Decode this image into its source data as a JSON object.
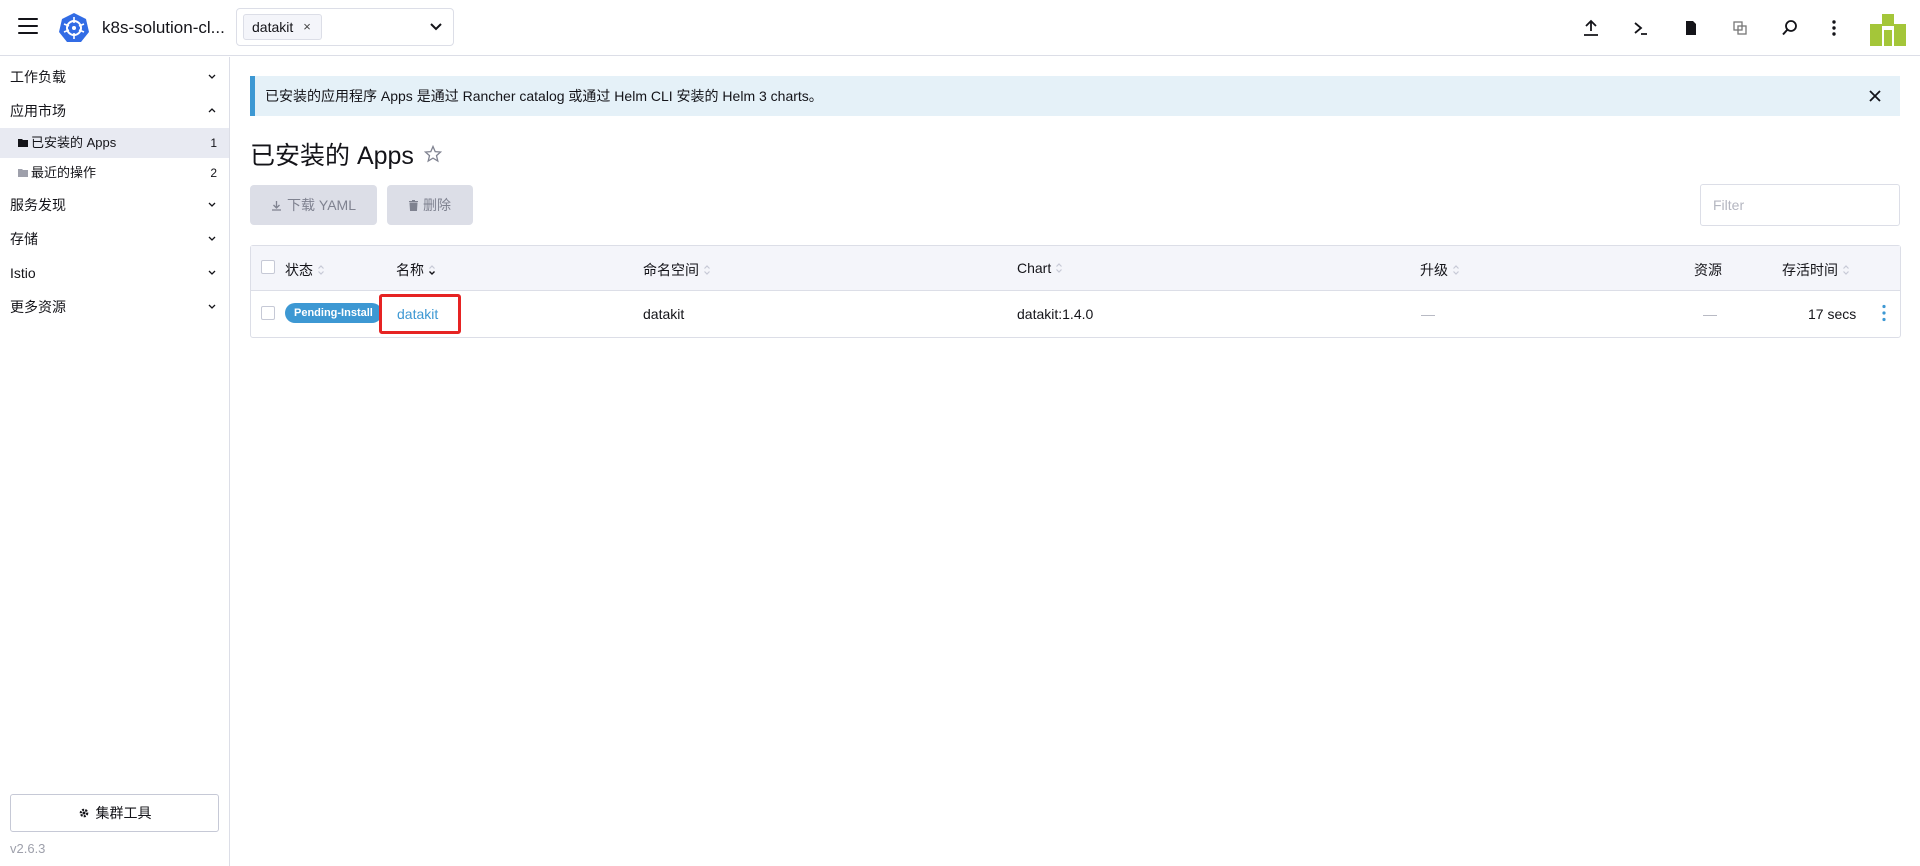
{
  "header": {
    "cluster_name": "k8s-solution-cl...",
    "namespace_chip": "datakit",
    "chip_remove": "×"
  },
  "sidebar": {
    "groups": [
      {
        "label": "工作负载"
      },
      {
        "label": "应用市场"
      },
      {
        "label": "服务发现"
      },
      {
        "label": "存储"
      },
      {
        "label": "Istio"
      },
      {
        "label": "更多资源"
      }
    ],
    "items": [
      {
        "label": "已安装的 Apps",
        "count": "1"
      },
      {
        "label": "最近的操作",
        "count": "2"
      }
    ],
    "cluster_tools": "集群工具",
    "version": "v2.6.3"
  },
  "banner": {
    "text": "已安装的应用程序 Apps 是通过 Rancher catalog 或通过 Helm CLI 安装的 Helm 3 charts。"
  },
  "page": {
    "title": "已安装的 Apps",
    "download_yaml": "下载 YAML",
    "delete": "删除",
    "filter_placeholder": "Filter"
  },
  "table": {
    "columns": [
      "状态",
      "名称",
      "命名空间",
      "Chart",
      "升级",
      "资源",
      "存活时间"
    ],
    "rows": [
      {
        "status": "Pending-Install",
        "name": "datakit",
        "namespace": "datakit",
        "chart": "datakit:1.4.0",
        "upgrade": "—",
        "resources": "—",
        "age": "17 secs"
      }
    ]
  },
  "colors": {
    "accent": "#3d98d3",
    "highlight": "#e62323",
    "avatar": "#a4c639"
  }
}
